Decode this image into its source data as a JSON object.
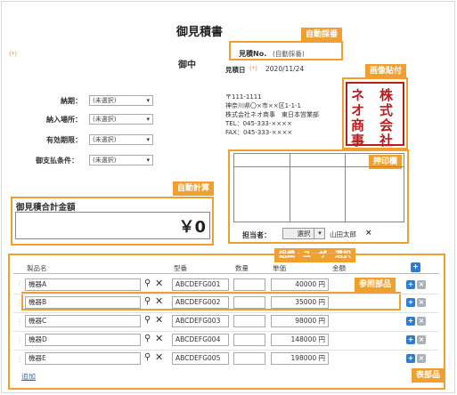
{
  "title": "御見積書",
  "required_mark": "(*)",
  "gochu": "御中",
  "estimate_no": {
    "label": "見積No.",
    "value": "(自動採番)"
  },
  "date": {
    "label": "見積日",
    "required": "(*)",
    "value": "2020/11/24"
  },
  "sender": {
    "zip": "〒111-1111",
    "address": "神奈川県〇×市××区1-1-1",
    "company": "株式会社ネオ商事　東日本営業部",
    "tel": "TEL：045-333-××××",
    "fax": "FAX：045-333-××××"
  },
  "stamp_chars": [
    "株",
    "式",
    "会",
    "社",
    "ネ",
    "オ",
    "商",
    "事"
  ],
  "conditions": [
    {
      "label": "納期：",
      "value": "(未選択)"
    },
    {
      "label": "納入場所：",
      "value": "(未選択)"
    },
    {
      "label": "有効期限：",
      "value": "(未選択)"
    },
    {
      "label": "御支払条件：",
      "value": "(未選択)"
    }
  ],
  "total": {
    "label": "御見積合計金額",
    "value": "￥0"
  },
  "person": {
    "label": "担当者：",
    "select_label": "選択",
    "name": "山田太郎"
  },
  "table": {
    "headers": [
      "製品名",
      "型番",
      "数量",
      "単価",
      "金額"
    ],
    "rows": [
      {
        "name": "機器A",
        "model": "ABCDEFG001",
        "price": "40000 円"
      },
      {
        "name": "機器B",
        "model": "ABCDEFG002",
        "price": "35000 円"
      },
      {
        "name": "機器C",
        "model": "ABCDEFG003",
        "price": "98000 円"
      },
      {
        "name": "機器D",
        "model": "ABCDEFG004",
        "price": "148000 円"
      },
      {
        "name": "機器E",
        "model": "ABCDEFG005",
        "price": "198000 円"
      }
    ],
    "add_link": "追加"
  },
  "annotations": {
    "auto_number": "自動採番",
    "image_paste": "画像貼付",
    "seal_box": "押印欄",
    "auto_calc": "自動計算",
    "org_user": "組織・ユーザー選択",
    "ref_parts": "参照部品",
    "table_parts": "表部品"
  },
  "accent_color": "#f0a030",
  "button_color": "#2e7bcf"
}
